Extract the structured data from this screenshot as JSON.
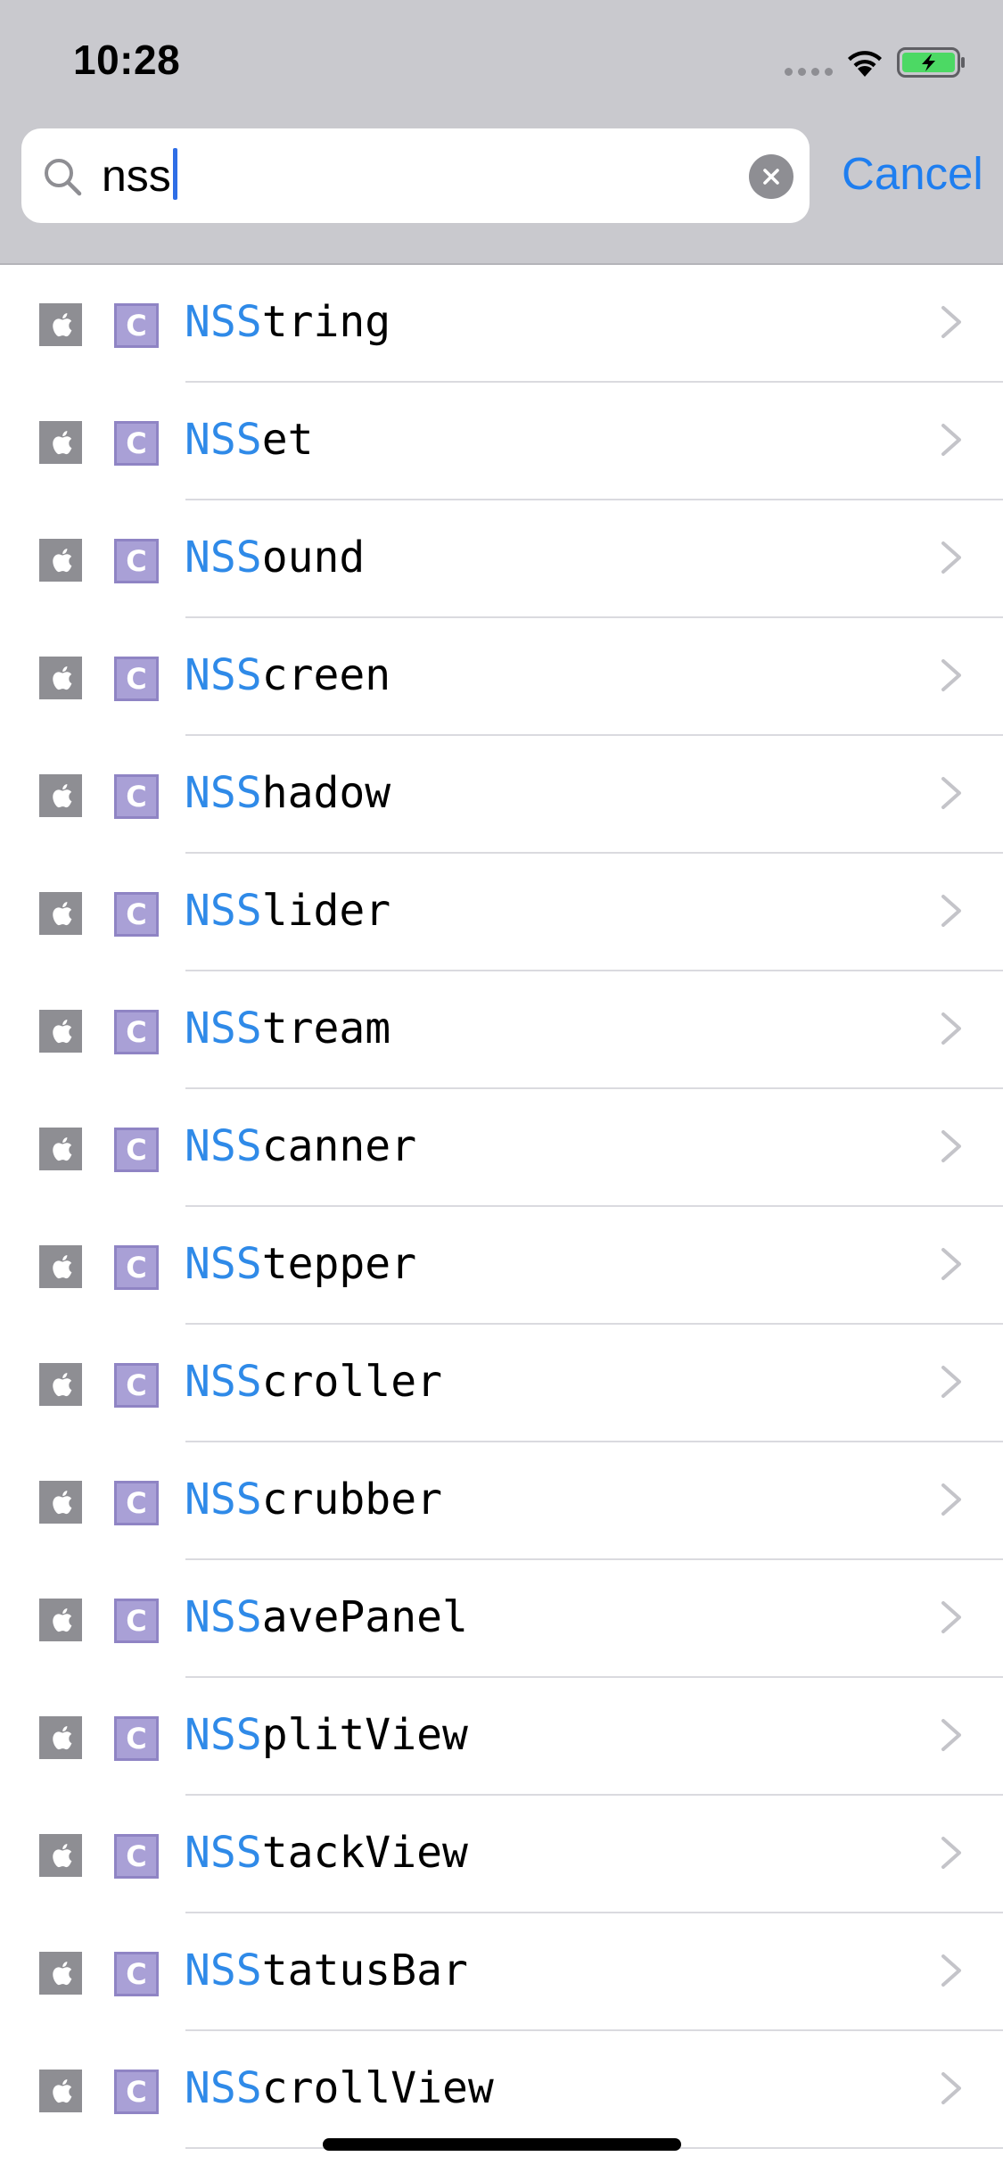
{
  "status_bar": {
    "time": "10:28",
    "signal_icon": "cellular-signal-dots",
    "wifi_icon": "wifi",
    "battery_icon": "battery-charging",
    "battery_color": "#4cd964"
  },
  "search": {
    "query": "nss",
    "search_icon": "magnifying-glass",
    "clear_icon": "x-circle-fill",
    "cancel_label": "Cancel"
  },
  "colors": {
    "header_background": "#c9c9ce",
    "accent": "#1e7ef0",
    "match_highlight": "#2f8ae8",
    "class_badge": "#a9a0d6",
    "platform_badge": "#8e8e93"
  },
  "results": {
    "platform_icon": "apple-logo",
    "kind_badge_letter": "C",
    "row_chevron": "chevron-right",
    "items": [
      {
        "match": "NSS",
        "rest": "tring"
      },
      {
        "match": "NSS",
        "rest": "et"
      },
      {
        "match": "NSS",
        "rest": "ound"
      },
      {
        "match": "NSS",
        "rest": "creen"
      },
      {
        "match": "NSS",
        "rest": "hadow"
      },
      {
        "match": "NSS",
        "rest": "lider"
      },
      {
        "match": "NSS",
        "rest": "tream"
      },
      {
        "match": "NSS",
        "rest": "canner"
      },
      {
        "match": "NSS",
        "rest": "tepper"
      },
      {
        "match": "NSS",
        "rest": "croller"
      },
      {
        "match": "NSS",
        "rest": "crubber"
      },
      {
        "match": "NSS",
        "rest": "avePanel"
      },
      {
        "match": "NSS",
        "rest": "plitView"
      },
      {
        "match": "NSS",
        "rest": "tackView"
      },
      {
        "match": "NSS",
        "rest": "tatusBar"
      },
      {
        "match": "NSS",
        "rest": "crollView"
      }
    ]
  }
}
